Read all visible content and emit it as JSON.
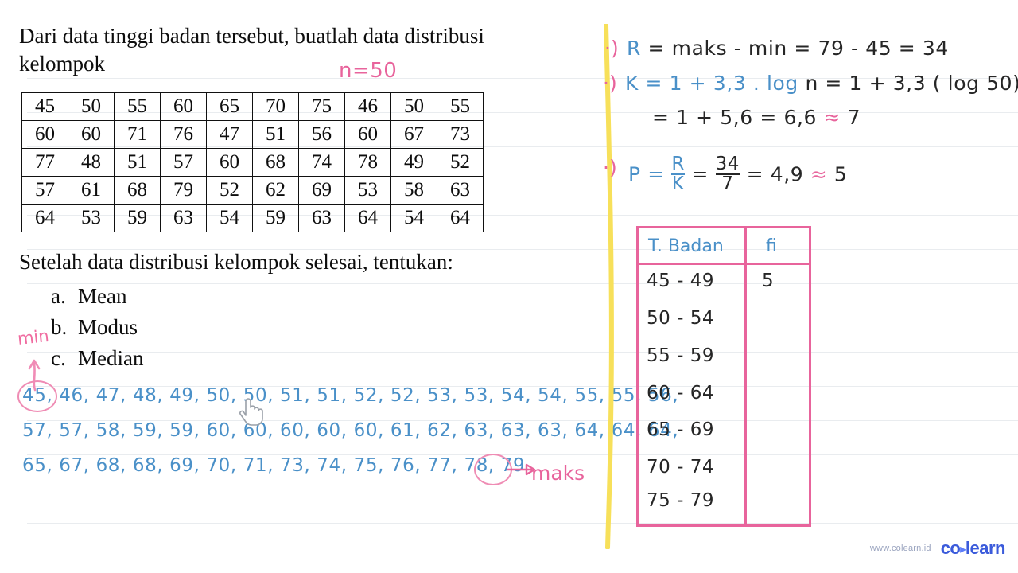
{
  "prompt": {
    "line1": "Dari data tinggi badan tersebut, buatlah data distribusi",
    "line2": "kelompok",
    "n_note": "n=50"
  },
  "data_table": {
    "rows": [
      [
        "45",
        "50",
        "55",
        "60",
        "65",
        "70",
        "75",
        "46",
        "50",
        "55"
      ],
      [
        "60",
        "60",
        "71",
        "76",
        "47",
        "51",
        "56",
        "60",
        "67",
        "73"
      ],
      [
        "77",
        "48",
        "51",
        "57",
        "60",
        "68",
        "74",
        "78",
        "49",
        "52"
      ],
      [
        "57",
        "61",
        "68",
        "79",
        "52",
        "62",
        "69",
        "53",
        "58",
        "63"
      ],
      [
        "64",
        "53",
        "59",
        "63",
        "54",
        "59",
        "63",
        "64",
        "54",
        "64"
      ]
    ]
  },
  "questions": {
    "heading": "Setelah data distribusi kelompok selesai, tentukan:",
    "items": [
      {
        "marker": "a.",
        "label": "Mean"
      },
      {
        "marker": "b.",
        "label": "Modus"
      },
      {
        "marker": "c.",
        "label": "Median"
      }
    ]
  },
  "sorted_data": {
    "line1": "45, 46, 47, 48, 49, 50, 50, 51, 51, 52, 52, 53, 53, 54, 54, 55, 55, 56,",
    "line2": "57, 57, 58, 59, 59, 60, 60, 60, 60, 60, 61, 62, 63, 63, 63, 64, 64, 64,",
    "line3": "65, 67, 68, 68, 69, 70, 71, 73, 74, 75, 76, 77, 78, 79",
    "min_label": "min",
    "maks_label": "maks"
  },
  "work": {
    "bullet1": "·)",
    "bullet2": "·)",
    "bullet3": "·)",
    "r_lhs": "R",
    "r_rhs": "= maks - min = 79 - 45 = 34",
    "k_lhs": "K = 1 + 3,3 . log",
    "k_rhs": "n = 1 + 3,3 ( log 50)",
    "k_line2": "= 1 + 5,6 = 6,6",
    "k_approx": "≈",
    "k_result": "7",
    "p_lhs": "P =",
    "p_frac1_num": "R",
    "p_frac1_den": "K",
    "p_eq1": "=",
    "p_frac2_num": "34",
    "p_frac2_den": "7",
    "p_eq2": "= 4,9",
    "p_approx": "≈",
    "p_result": "5"
  },
  "freq_table": {
    "header": [
      "T. Badan",
      "fi"
    ],
    "rows": [
      {
        "interval": "45 - 49",
        "fi": "5"
      },
      {
        "interval": "50 - 54",
        "fi": ""
      },
      {
        "interval": "55 - 59",
        "fi": ""
      },
      {
        "interval": "60 - 64",
        "fi": ""
      },
      {
        "interval": "65 - 69",
        "fi": ""
      },
      {
        "interval": "70 - 74",
        "fi": ""
      },
      {
        "interval": "75 - 79",
        "fi": ""
      }
    ]
  },
  "branding": {
    "url": "www.colearn.id",
    "name_part1": "co",
    "name_dot": "▸",
    "name_part2": "learn"
  },
  "colors": {
    "ink_blue": "#4a90c8",
    "ink_pink": "#e8649c",
    "ink_dark": "#262626",
    "divider_yellow": "#f7e05a",
    "brand_blue": "#3b5bdb"
  }
}
